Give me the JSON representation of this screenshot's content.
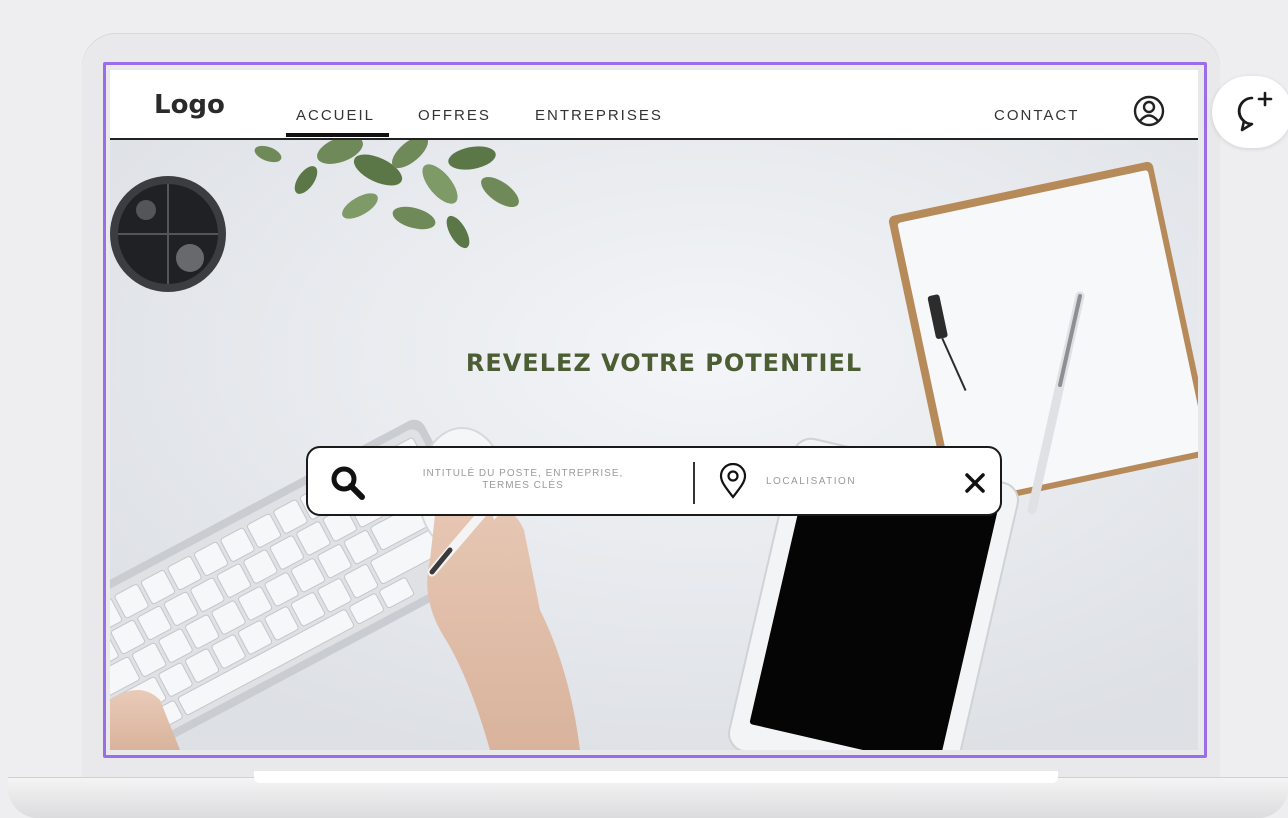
{
  "nav": {
    "logo": "Logo",
    "links": [
      "ACCUEIL",
      "OFFRES",
      "ENTREPRISES"
    ],
    "active_link": "ACCUEIL",
    "contact": "CONTACT",
    "user_icon": "user-circle-icon"
  },
  "hero": {
    "title": "REVELEZ VOTRE POTENTIEL"
  },
  "search": {
    "search_icon": "search-icon",
    "keywords_placeholder_line1": "INTITULÉ DU POSTE, ENTREPRISE,",
    "keywords_placeholder_line2": "TERMES CLÉS",
    "location_icon": "map-pin-icon",
    "location_placeholder": "LOCALISATION",
    "clear_icon": "close-icon"
  },
  "chat_button": {
    "icon": "chat-add-icon"
  },
  "colors": {
    "title_green": "#4c5d34",
    "selection_frame": "#9a6ee8",
    "nav_text": "#333333",
    "placeholder": "#9a9a9a"
  }
}
